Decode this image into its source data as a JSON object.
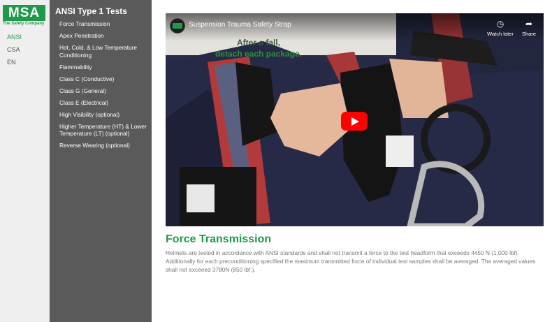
{
  "brand": {
    "logo_text": "MSA",
    "tagline": "The Safety Company",
    "color": "#1f9a4b"
  },
  "languages": [
    {
      "label": "ANSI",
      "active": true
    },
    {
      "label": "CSA",
      "active": false
    },
    {
      "label": "EN",
      "active": false
    }
  ],
  "menu": {
    "title": "ANSI Type 1 Tests",
    "items": [
      "Force Transmission",
      "Apex Penetration",
      "Hot, Cold, & Low Temperature Conditioning",
      "Flammability",
      "Class C (Conductive)",
      "Class G (General)",
      "Class E (Electrical)",
      "High Visibility (optional)",
      "Higher Temperature (HT) & Lower Temperature (LT) (optional)",
      "Reverse Wearing (optional)"
    ]
  },
  "video": {
    "title": "Suspension Trauma Safety Strap",
    "caption_line1": "After a fall,",
    "caption_line2": "detach each package.",
    "watch_later_label": "Watch later",
    "share_label": "Share",
    "watch_later_icon": "clock-icon",
    "share_icon": "share-arrow-icon",
    "play_icon": "play-icon",
    "play_color": "#ff0000"
  },
  "content": {
    "heading": "Force Transmission",
    "body": "Helmets are tested in accordance with ANSI standards and shall not transmit a force to the test headform that exceeds 4450 N (1,000 lbf). Additionally for each preconditioning specified the masimum transmitted force of individual test samples shall be averaged. The averaged values shall not exceeed 3780N (850 lbf.)."
  }
}
